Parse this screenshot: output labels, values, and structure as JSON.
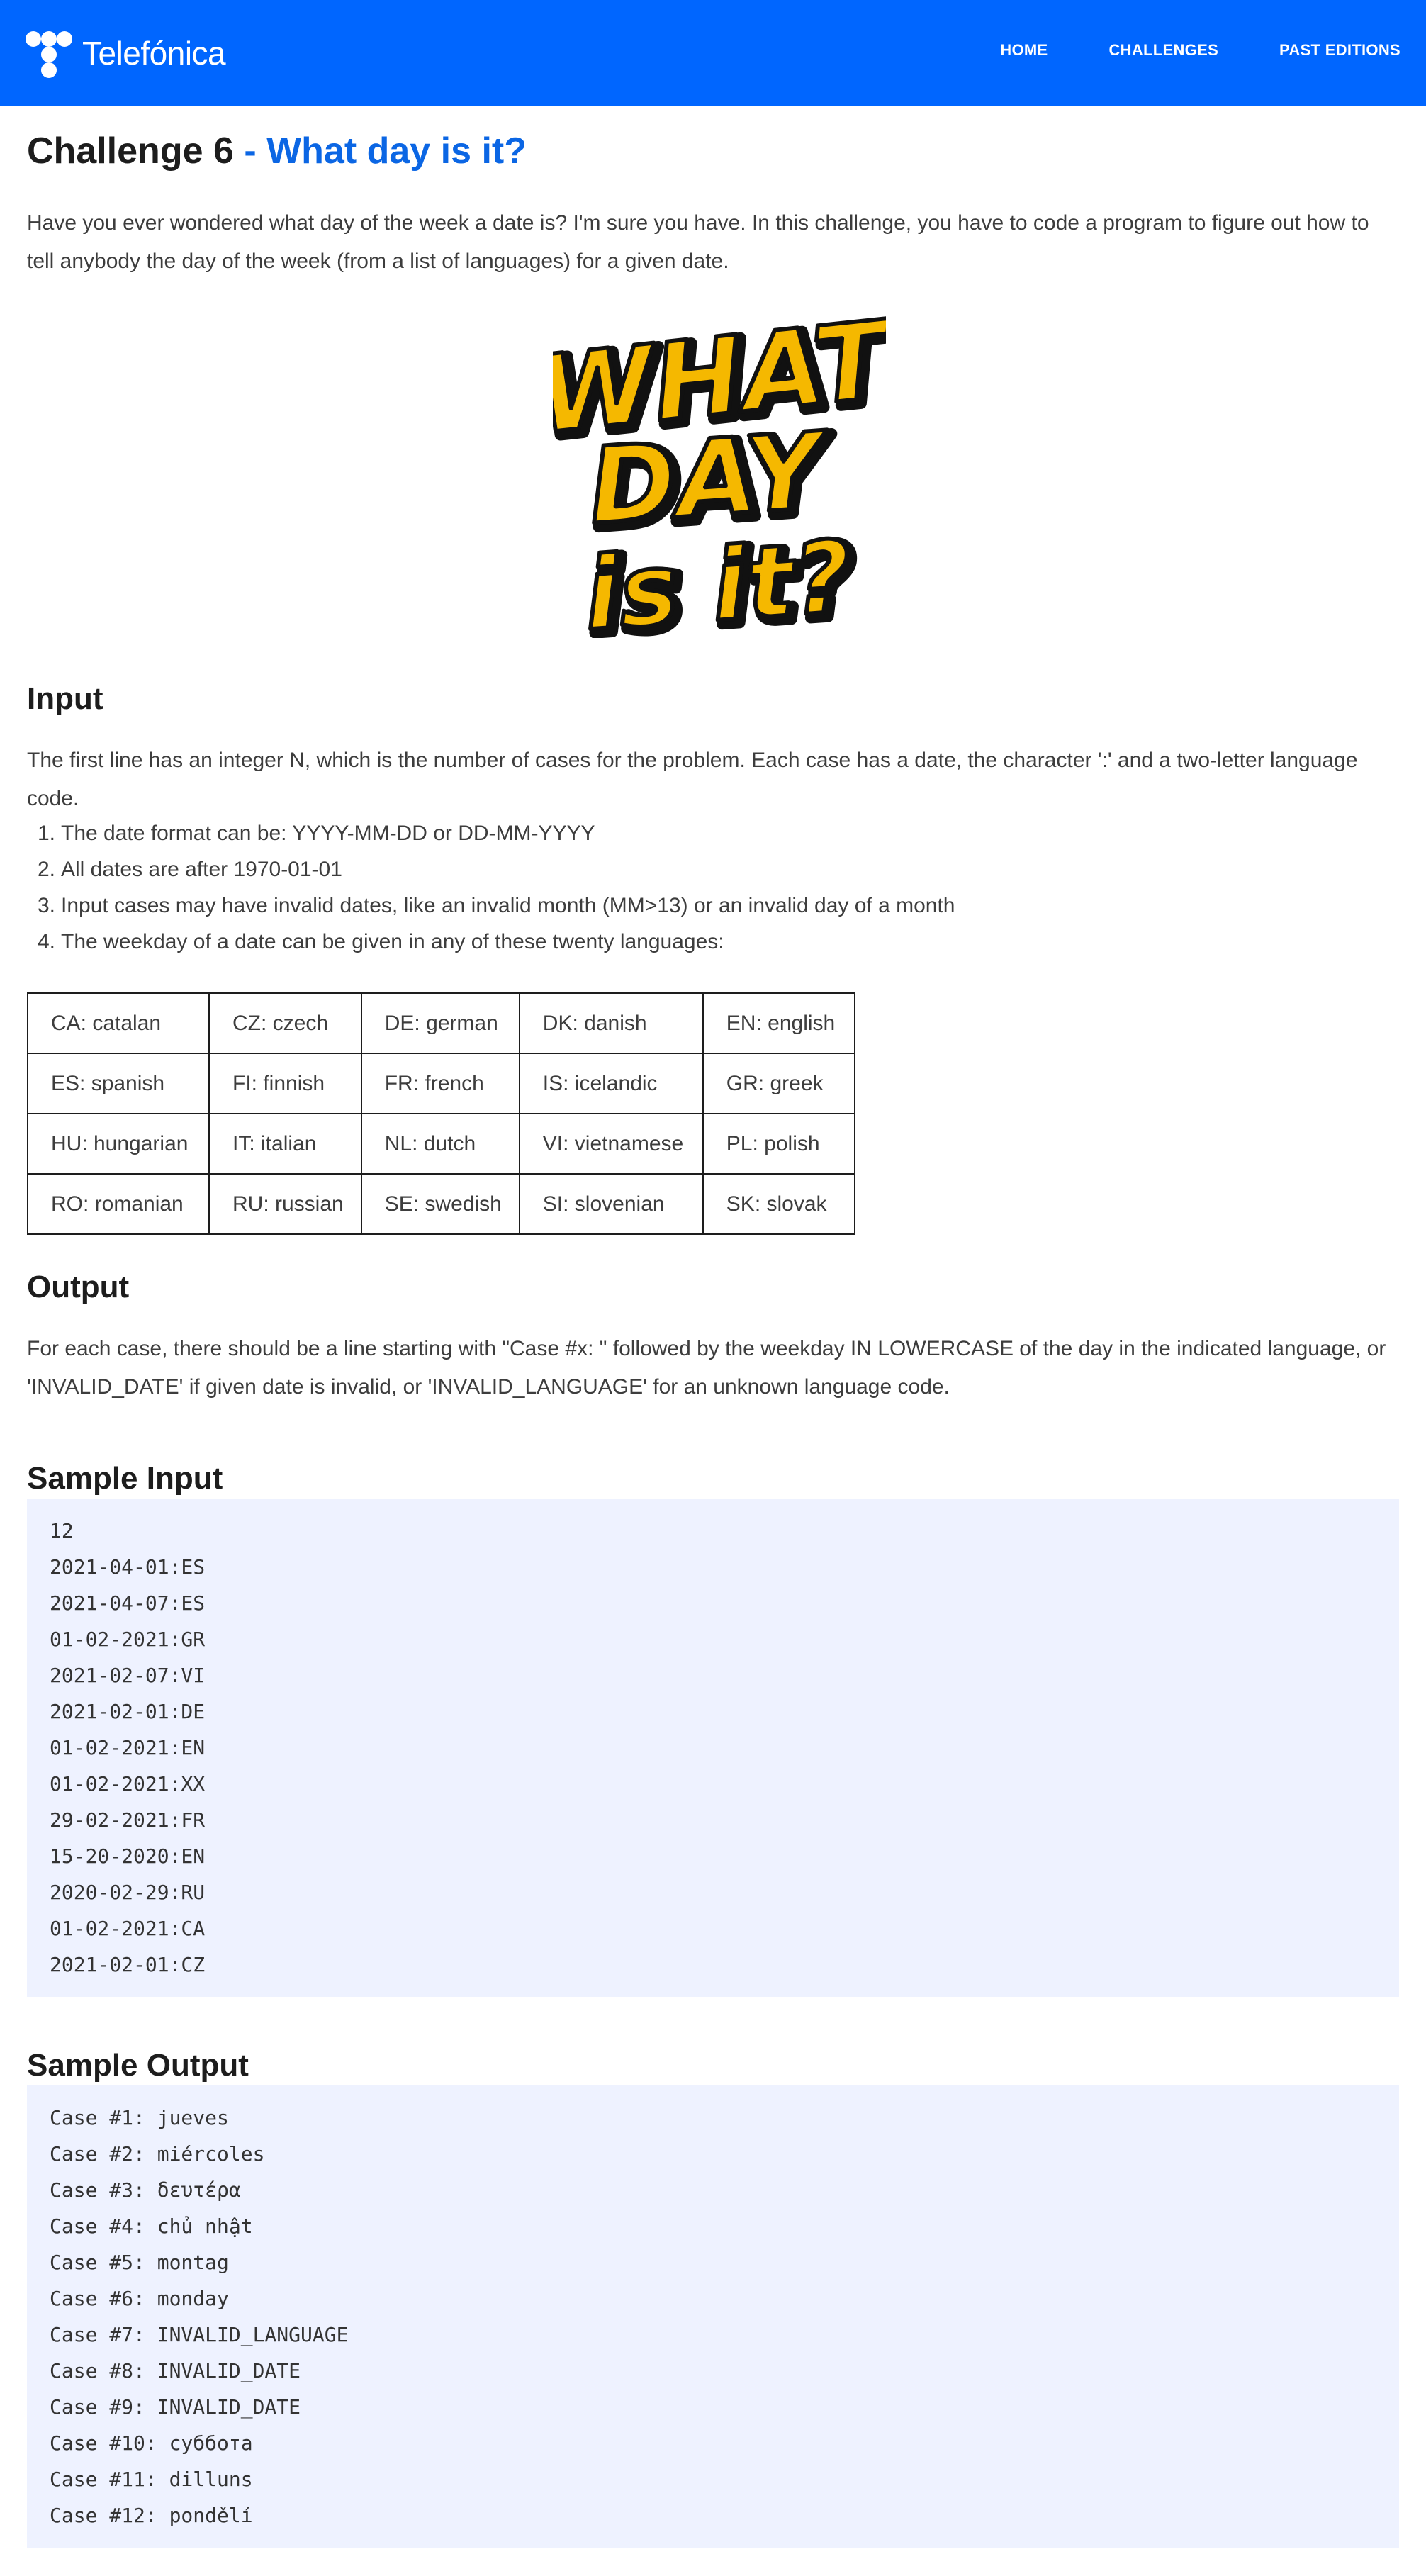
{
  "nav": {
    "brand": "Telefónica",
    "links": [
      "HOME",
      "CHALLENGES",
      "PAST EDITIONS"
    ]
  },
  "title": {
    "strong": "Challenge 6",
    "light": " - What day is it?"
  },
  "intro": "Have you ever wondered what day of the week a date is? I'm sure you have. In this challenge, you have to code a program to figure out how to tell anybody the day of the week (from a list of languages) for a given date.",
  "image": {
    "icon": "what-day-is-it-lettering",
    "lines": [
      "WHAT",
      "DAY",
      "is it?"
    ],
    "fill": "#f5b800",
    "outline": "#111111"
  },
  "input": {
    "heading": "Input",
    "text": "The first line has an integer N, which is the number of cases for the problem. Each case has a date, the character ':' and a two-letter language code.",
    "rules": [
      "The date format can be: YYYY-MM-DD or DD-MM-YYYY",
      "All dates are after 1970-01-01",
      "Input cases may have invalid dates, like an invalid month (MM>13) or an invalid day of a month",
      "The weekday of a date can be given in any of these twenty languages:"
    ],
    "languages": [
      [
        "CA: catalan",
        "CZ: czech",
        "DE: german",
        "DK: danish",
        "EN: english"
      ],
      [
        "ES: spanish",
        "FI: finnish",
        "FR: french",
        "IS: icelandic",
        "GR: greek"
      ],
      [
        "HU: hungarian",
        "IT: italian",
        "NL: dutch",
        "VI: vietnamese",
        "PL: polish"
      ],
      [
        "RO: romanian",
        "RU: russian",
        "SE: swedish",
        "SI: slovenian",
        "SK: slovak"
      ]
    ]
  },
  "output": {
    "heading": "Output",
    "text": "For each case, there should be a line starting with \"Case #x: \" followed by the weekday IN LOWERCASE of the day in the indicated language, or 'INVALID_DATE' if given date is invalid, or 'INVALID_LANGUAGE' for an unknown language code."
  },
  "sample_input": {
    "heading": "Sample Input",
    "lines": [
      "12",
      "2021-04-01:ES",
      "2021-04-07:ES",
      "01-02-2021:GR",
      "2021-02-07:VI",
      "2021-02-01:DE",
      "01-02-2021:EN",
      "01-02-2021:XX",
      "29-02-2021:FR",
      "15-20-2020:EN",
      "2020-02-29:RU",
      "01-02-2021:CA",
      "2021-02-01:CZ"
    ]
  },
  "sample_output": {
    "heading": "Sample Output",
    "lines": [
      "Case #1: jueves",
      "Case #2: miércoles",
      "Case #3: δευτέρα",
      "Case #4: chủ nhật",
      "Case #5: montag",
      "Case #6: monday",
      "Case #7: INVALID_LANGUAGE",
      "Case #8: INVALID_DATE",
      "Case #9: INVALID_DATE",
      "Case #10: суббота",
      "Case #11: dilluns",
      "Case #12: pondělí"
    ]
  },
  "colors": {
    "navbar": "#0066ff",
    "title_accent": "#0b66e4",
    "code_bg": "#eef2ff"
  }
}
